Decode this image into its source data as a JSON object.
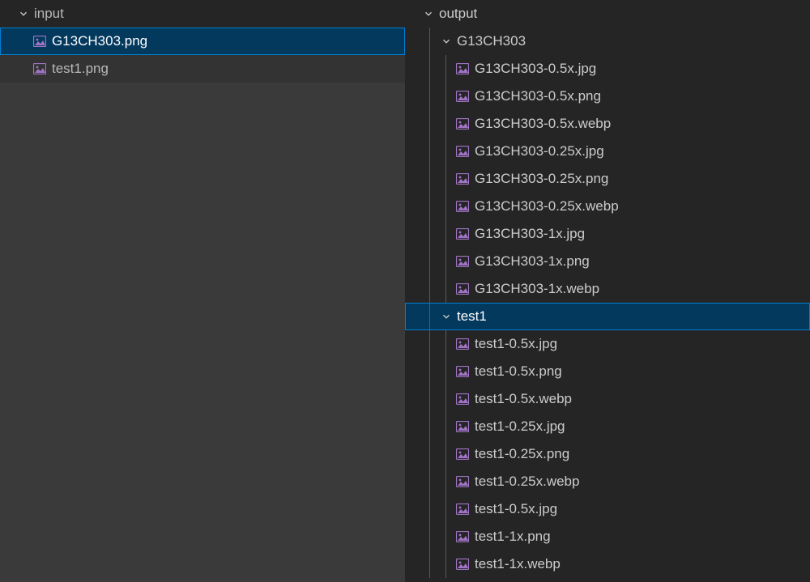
{
  "left": {
    "folder_label": "input",
    "files": [
      {
        "name": "G13CH303.png",
        "selected": true
      },
      {
        "name": "test1.png",
        "selected": false
      }
    ]
  },
  "right": {
    "folder_label": "output",
    "subfolders": [
      {
        "name": "G13CH303",
        "selected": false,
        "files": [
          "G13CH303-0.5x.jpg",
          "G13CH303-0.5x.png",
          "G13CH303-0.5x.webp",
          "G13CH303-0.25x.jpg",
          "G13CH303-0.25x.png",
          "G13CH303-0.25x.webp",
          "G13CH303-1x.jpg",
          "G13CH303-1x.png",
          "G13CH303-1x.webp"
        ]
      },
      {
        "name": "test1",
        "selected": true,
        "files": [
          "test1-0.5x.jpg",
          "test1-0.5x.png",
          "test1-0.5x.webp",
          "test1-0.25x.jpg",
          "test1-0.25x.png",
          "test1-0.25x.webp",
          "test1-0.5x.jpg",
          "test1-1x.png",
          "test1-1x.webp"
        ]
      }
    ]
  },
  "colors": {
    "selection_focused_bg": "#04395e",
    "selection_focused_border": "#007fd4",
    "icon_purple": "#a074c4"
  }
}
